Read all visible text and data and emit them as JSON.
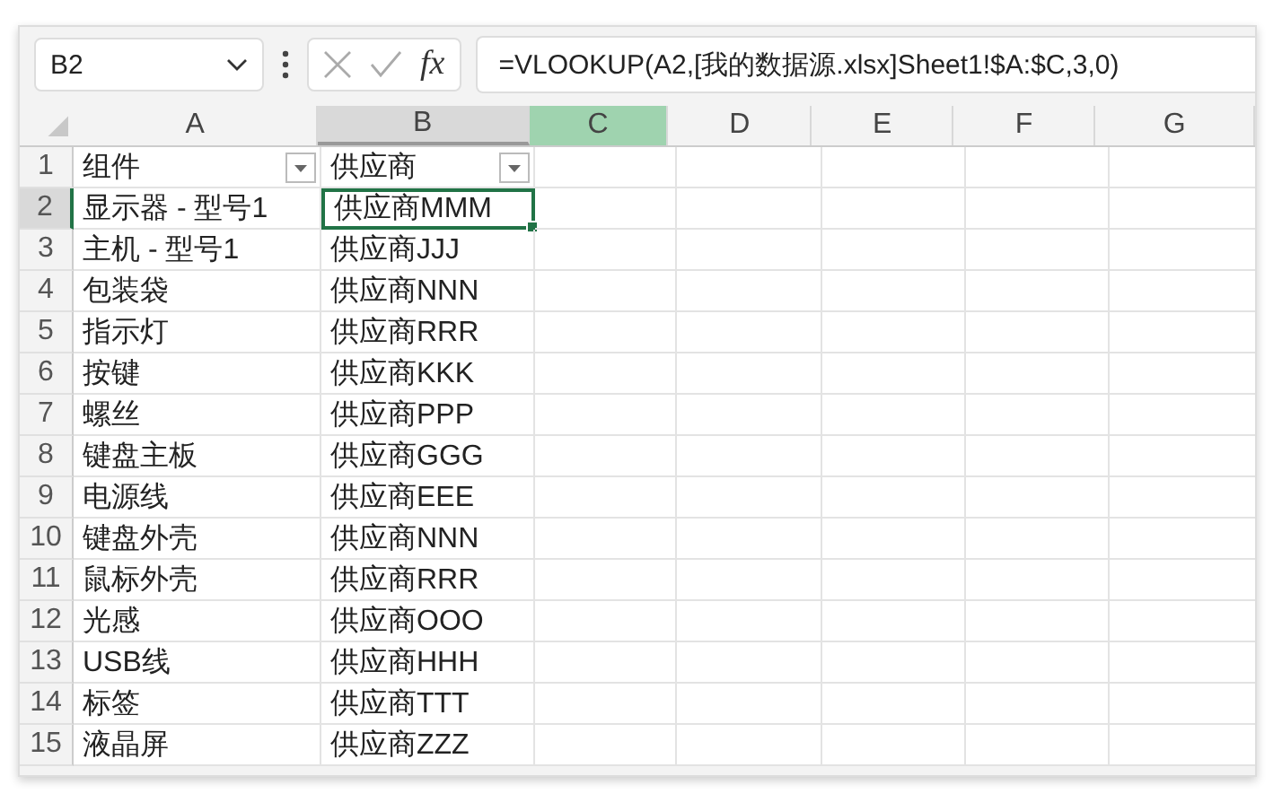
{
  "formula_bar": {
    "name_box": "B2",
    "function_label": "fx",
    "formula": "=VLOOKUP(A2,[我的数据源.xlsx]Sheet1!$A:$C,3,0)"
  },
  "columns": [
    {
      "label": "A",
      "selected": false,
      "highlighted": false
    },
    {
      "label": "B",
      "selected": true,
      "highlighted": false
    },
    {
      "label": "C",
      "selected": false,
      "highlighted": true
    },
    {
      "label": "D",
      "selected": false,
      "highlighted": false
    },
    {
      "label": "E",
      "selected": false,
      "highlighted": false
    },
    {
      "label": "F",
      "selected": false,
      "highlighted": false
    },
    {
      "label": "G",
      "selected": false,
      "highlighted": false
    }
  ],
  "rows": [
    {
      "number": "1",
      "selected": false,
      "cells": [
        {
          "text": "组件",
          "filter": true,
          "selected": false
        },
        {
          "text": "供应商",
          "filter": true,
          "selected": false
        }
      ]
    },
    {
      "number": "2",
      "selected": true,
      "cells": [
        {
          "text": "显示器 - 型号1",
          "filter": false,
          "selected": false
        },
        {
          "text": "供应商MMM",
          "filter": false,
          "selected": true
        }
      ]
    },
    {
      "number": "3",
      "selected": false,
      "cells": [
        {
          "text": "主机 - 型号1",
          "filter": false,
          "selected": false
        },
        {
          "text": "供应商JJJ",
          "filter": false,
          "selected": false
        }
      ]
    },
    {
      "number": "4",
      "selected": false,
      "cells": [
        {
          "text": "包装袋",
          "filter": false,
          "selected": false
        },
        {
          "text": "供应商NNN",
          "filter": false,
          "selected": false
        }
      ]
    },
    {
      "number": "5",
      "selected": false,
      "cells": [
        {
          "text": "指示灯",
          "filter": false,
          "selected": false
        },
        {
          "text": "供应商RRR",
          "filter": false,
          "selected": false
        }
      ]
    },
    {
      "number": "6",
      "selected": false,
      "cells": [
        {
          "text": "按键",
          "filter": false,
          "selected": false
        },
        {
          "text": "供应商KKK",
          "filter": false,
          "selected": false
        }
      ]
    },
    {
      "number": "7",
      "selected": false,
      "cells": [
        {
          "text": "螺丝",
          "filter": false,
          "selected": false
        },
        {
          "text": "供应商PPP",
          "filter": false,
          "selected": false
        }
      ]
    },
    {
      "number": "8",
      "selected": false,
      "cells": [
        {
          "text": "键盘主板",
          "filter": false,
          "selected": false
        },
        {
          "text": "供应商GGG",
          "filter": false,
          "selected": false
        }
      ]
    },
    {
      "number": "9",
      "selected": false,
      "cells": [
        {
          "text": "电源线",
          "filter": false,
          "selected": false
        },
        {
          "text": "供应商EEE",
          "filter": false,
          "selected": false
        }
      ]
    },
    {
      "number": "10",
      "selected": false,
      "cells": [
        {
          "text": "键盘外壳",
          "filter": false,
          "selected": false
        },
        {
          "text": "供应商NNN",
          "filter": false,
          "selected": false
        }
      ]
    },
    {
      "number": "11",
      "selected": false,
      "cells": [
        {
          "text": "鼠标外壳",
          "filter": false,
          "selected": false
        },
        {
          "text": "供应商RRR",
          "filter": false,
          "selected": false
        }
      ]
    },
    {
      "number": "12",
      "selected": false,
      "cells": [
        {
          "text": "光感",
          "filter": false,
          "selected": false
        },
        {
          "text": "供应商OOO",
          "filter": false,
          "selected": false
        }
      ]
    },
    {
      "number": "13",
      "selected": false,
      "cells": [
        {
          "text": "USB线",
          "filter": false,
          "selected": false
        },
        {
          "text": "供应商HHH",
          "filter": false,
          "selected": false
        }
      ]
    },
    {
      "number": "14",
      "selected": false,
      "cells": [
        {
          "text": "标签",
          "filter": false,
          "selected": false
        },
        {
          "text": "供应商TTT",
          "filter": false,
          "selected": false
        }
      ]
    },
    {
      "number": "15",
      "selected": false,
      "cells": [
        {
          "text": "液晶屏",
          "filter": false,
          "selected": false
        },
        {
          "text": "供应商ZZZ",
          "filter": false,
          "selected": false
        }
      ]
    }
  ]
}
